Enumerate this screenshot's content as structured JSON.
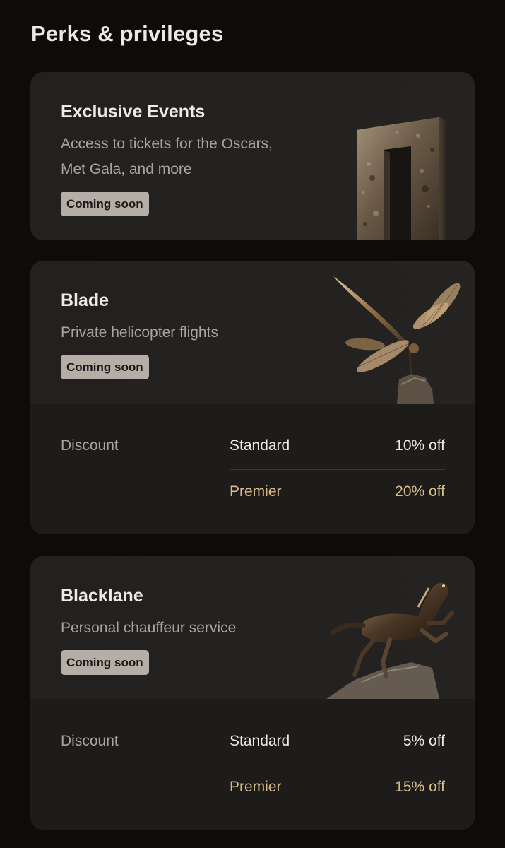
{
  "page": {
    "title": "Perks & privileges"
  },
  "colors": {
    "background": "#0e0c0a",
    "card": "#1d1b19",
    "badge": "#b5aea6",
    "premier_accent": "#d8bd8c"
  },
  "perks": [
    {
      "title": "Exclusive Events",
      "description": "Access to tickets for the Oscars, Met Gala, and more",
      "badge": "Coming soon",
      "art_icon": "monolith-arch-sculpture"
    },
    {
      "title": "Blade",
      "description": "Private helicopter flights",
      "badge": "Coming soon",
      "art_icon": "dragonfly-sculpture",
      "discount": {
        "label": "Discount",
        "tiers": [
          {
            "name": "Standard",
            "value": "10% off"
          },
          {
            "name": "Premier",
            "value": "20% off"
          }
        ]
      }
    },
    {
      "title": "Blacklane",
      "description": "Personal chauffeur service",
      "badge": "Coming soon",
      "art_icon": "horse-sculpture",
      "discount": {
        "label": "Discount",
        "tiers": [
          {
            "name": "Standard",
            "value": "5% off"
          },
          {
            "name": "Premier",
            "value": "15% off"
          }
        ]
      }
    }
  ]
}
